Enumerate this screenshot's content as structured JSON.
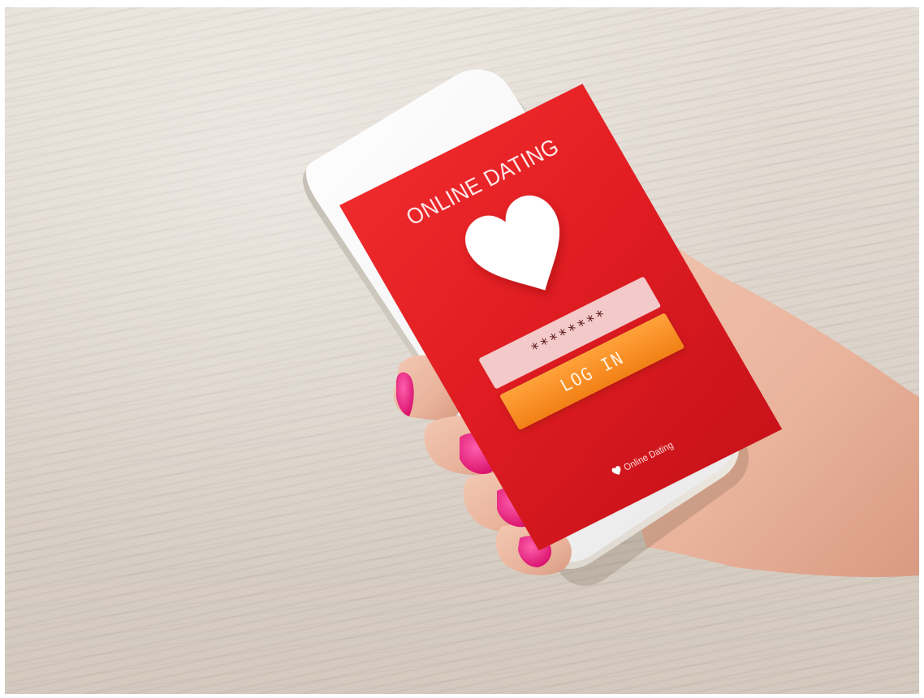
{
  "app": {
    "title": "ONLINE DATING",
    "brand_footer": "Online Dating"
  },
  "login": {
    "password_masked": "********",
    "button_label": "LOG IN"
  },
  "icons": {
    "main": "heart-icon",
    "footer": "heart-icon"
  },
  "colors": {
    "screen_red": "#e01d22",
    "button_orange": "#f28016",
    "field_pink": "#f3c9c9",
    "nail_pink": "#e8197a",
    "phone_white": "#fafafa"
  }
}
